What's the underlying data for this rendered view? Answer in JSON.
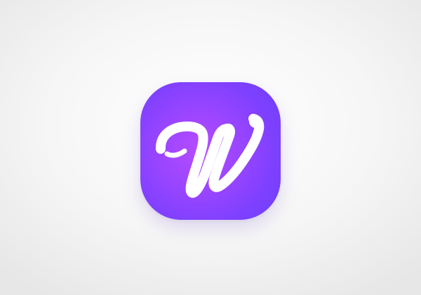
{
  "app_icon": {
    "letter": "W",
    "icon_name": "script-w-logo-icon",
    "colors": {
      "background_light": "#b64cff",
      "background_mid": "#9a45ff",
      "background_dark": "#6f3ef9",
      "glyph": "#ffffff",
      "page_background": "#f3f3f3"
    }
  }
}
